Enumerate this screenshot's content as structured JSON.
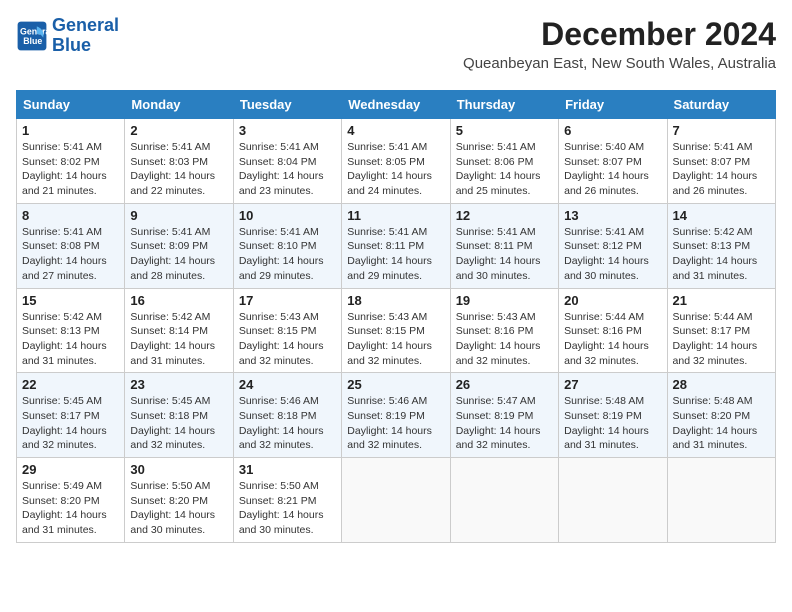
{
  "logo": {
    "line1": "General",
    "line2": "Blue"
  },
  "title": "December 2024",
  "location": "Queanbeyan East, New South Wales, Australia",
  "days_of_week": [
    "Sunday",
    "Monday",
    "Tuesday",
    "Wednesday",
    "Thursday",
    "Friday",
    "Saturday"
  ],
  "weeks": [
    [
      {
        "day": 1,
        "info": "Sunrise: 5:41 AM\nSunset: 8:02 PM\nDaylight: 14 hours\nand 21 minutes."
      },
      {
        "day": 2,
        "info": "Sunrise: 5:41 AM\nSunset: 8:03 PM\nDaylight: 14 hours\nand 22 minutes."
      },
      {
        "day": 3,
        "info": "Sunrise: 5:41 AM\nSunset: 8:04 PM\nDaylight: 14 hours\nand 23 minutes."
      },
      {
        "day": 4,
        "info": "Sunrise: 5:41 AM\nSunset: 8:05 PM\nDaylight: 14 hours\nand 24 minutes."
      },
      {
        "day": 5,
        "info": "Sunrise: 5:41 AM\nSunset: 8:06 PM\nDaylight: 14 hours\nand 25 minutes."
      },
      {
        "day": 6,
        "info": "Sunrise: 5:40 AM\nSunset: 8:07 PM\nDaylight: 14 hours\nand 26 minutes."
      },
      {
        "day": 7,
        "info": "Sunrise: 5:41 AM\nSunset: 8:07 PM\nDaylight: 14 hours\nand 26 minutes."
      }
    ],
    [
      {
        "day": 8,
        "info": "Sunrise: 5:41 AM\nSunset: 8:08 PM\nDaylight: 14 hours\nand 27 minutes."
      },
      {
        "day": 9,
        "info": "Sunrise: 5:41 AM\nSunset: 8:09 PM\nDaylight: 14 hours\nand 28 minutes."
      },
      {
        "day": 10,
        "info": "Sunrise: 5:41 AM\nSunset: 8:10 PM\nDaylight: 14 hours\nand 29 minutes."
      },
      {
        "day": 11,
        "info": "Sunrise: 5:41 AM\nSunset: 8:11 PM\nDaylight: 14 hours\nand 29 minutes."
      },
      {
        "day": 12,
        "info": "Sunrise: 5:41 AM\nSunset: 8:11 PM\nDaylight: 14 hours\nand 30 minutes."
      },
      {
        "day": 13,
        "info": "Sunrise: 5:41 AM\nSunset: 8:12 PM\nDaylight: 14 hours\nand 30 minutes."
      },
      {
        "day": 14,
        "info": "Sunrise: 5:42 AM\nSunset: 8:13 PM\nDaylight: 14 hours\nand 31 minutes."
      }
    ],
    [
      {
        "day": 15,
        "info": "Sunrise: 5:42 AM\nSunset: 8:13 PM\nDaylight: 14 hours\nand 31 minutes."
      },
      {
        "day": 16,
        "info": "Sunrise: 5:42 AM\nSunset: 8:14 PM\nDaylight: 14 hours\nand 31 minutes."
      },
      {
        "day": 17,
        "info": "Sunrise: 5:43 AM\nSunset: 8:15 PM\nDaylight: 14 hours\nand 32 minutes."
      },
      {
        "day": 18,
        "info": "Sunrise: 5:43 AM\nSunset: 8:15 PM\nDaylight: 14 hours\nand 32 minutes."
      },
      {
        "day": 19,
        "info": "Sunrise: 5:43 AM\nSunset: 8:16 PM\nDaylight: 14 hours\nand 32 minutes."
      },
      {
        "day": 20,
        "info": "Sunrise: 5:44 AM\nSunset: 8:16 PM\nDaylight: 14 hours\nand 32 minutes."
      },
      {
        "day": 21,
        "info": "Sunrise: 5:44 AM\nSunset: 8:17 PM\nDaylight: 14 hours\nand 32 minutes."
      }
    ],
    [
      {
        "day": 22,
        "info": "Sunrise: 5:45 AM\nSunset: 8:17 PM\nDaylight: 14 hours\nand 32 minutes."
      },
      {
        "day": 23,
        "info": "Sunrise: 5:45 AM\nSunset: 8:18 PM\nDaylight: 14 hours\nand 32 minutes."
      },
      {
        "day": 24,
        "info": "Sunrise: 5:46 AM\nSunset: 8:18 PM\nDaylight: 14 hours\nand 32 minutes."
      },
      {
        "day": 25,
        "info": "Sunrise: 5:46 AM\nSunset: 8:19 PM\nDaylight: 14 hours\nand 32 minutes."
      },
      {
        "day": 26,
        "info": "Sunrise: 5:47 AM\nSunset: 8:19 PM\nDaylight: 14 hours\nand 32 minutes."
      },
      {
        "day": 27,
        "info": "Sunrise: 5:48 AM\nSunset: 8:19 PM\nDaylight: 14 hours\nand 31 minutes."
      },
      {
        "day": 28,
        "info": "Sunrise: 5:48 AM\nSunset: 8:20 PM\nDaylight: 14 hours\nand 31 minutes."
      }
    ],
    [
      {
        "day": 29,
        "info": "Sunrise: 5:49 AM\nSunset: 8:20 PM\nDaylight: 14 hours\nand 31 minutes."
      },
      {
        "day": 30,
        "info": "Sunrise: 5:50 AM\nSunset: 8:20 PM\nDaylight: 14 hours\nand 30 minutes."
      },
      {
        "day": 31,
        "info": "Sunrise: 5:50 AM\nSunset: 8:21 PM\nDaylight: 14 hours\nand 30 minutes."
      },
      null,
      null,
      null,
      null
    ]
  ]
}
